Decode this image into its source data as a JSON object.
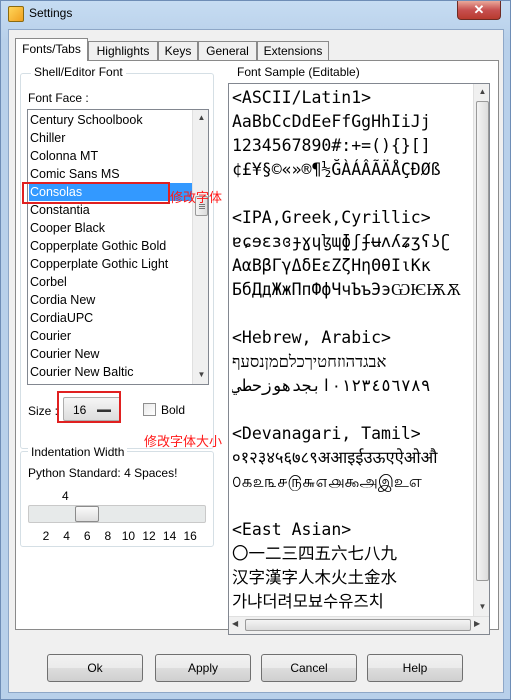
{
  "window": {
    "title": "Settings",
    "close_glyph": "✕"
  },
  "tabs": [
    {
      "label": "Fonts/Tabs",
      "active": true
    },
    {
      "label": "Highlights"
    },
    {
      "label": "Keys"
    },
    {
      "label": "General"
    },
    {
      "label": "Extensions"
    }
  ],
  "shell_font": {
    "group_label": "Shell/Editor Font",
    "font_face_label": "Font Face :",
    "fonts": [
      "Century Schoolbook",
      "Chiller",
      "Colonna MT",
      "Comic Sans MS",
      "Consolas",
      "Constantia",
      "Cooper Black",
      "Copperplate Gothic Bold",
      "Copperplate Gothic Light",
      "Corbel",
      "Cordia New",
      "CordiaUPC",
      "Courier",
      "Courier New",
      "Courier New Baltic"
    ],
    "selected_font": "Consolas",
    "size_label": "Size :",
    "size_value": "16",
    "bold_label": "Bold"
  },
  "annotations": {
    "font_face": "修改字体",
    "font_size": "修改字体大小"
  },
  "indentation": {
    "group_label": "Indentation Width",
    "standard_text": "Python Standard: 4 Spaces!",
    "current_value": "4",
    "ticks": [
      "2",
      "4",
      "6",
      "8",
      "10",
      "12",
      "14",
      "16"
    ],
    "min": 2,
    "max": 16,
    "value": 4
  },
  "font_sample": {
    "group_label": "Font Sample (Editable)",
    "lines": [
      "<ASCII/Latin1>",
      "AaBbCcDdEeFfGgHhIiJj",
      "1234567890#:+=(){}[]",
      "¢£¥§©«»®¶½ĞÀÁÂÃÄÅÇÐØß",
      "",
      "<IPA,Greek,Cyrillic>",
      "ɐɕɘɛɜɞɟɣɥɮɰɸʃʄʉʌʎʑʒʕʖʗ",
      "ΑαΒβΓγΔδΕεΖζΗηΘθΙιΚκ",
      "БбДдЖжПпФфЧчЪъЭэѠѤѬѪ",
      "",
      "<Hebrew, Arabic>",
      "אבגדהוזחטיךכלםמןנסעף",
      "٠١٢٣٤٥٦٧٨٩ابجدهوزحطي",
      "",
      "<Devanagari, Tamil>",
      "०१२३४५६७८९अआइईउऊएऐओऔ",
      "௦௧௨௩௪௫௬௭௮௯அஇஉஎ",
      "",
      "<East Asian>",
      "〇一二三四五六七八九",
      "汉字漢字人木火土金水",
      "가냐더려모뵤수유즈치"
    ]
  },
  "buttons": {
    "ok": "Ok",
    "apply": "Apply",
    "cancel": "Cancel",
    "help": "Help"
  }
}
